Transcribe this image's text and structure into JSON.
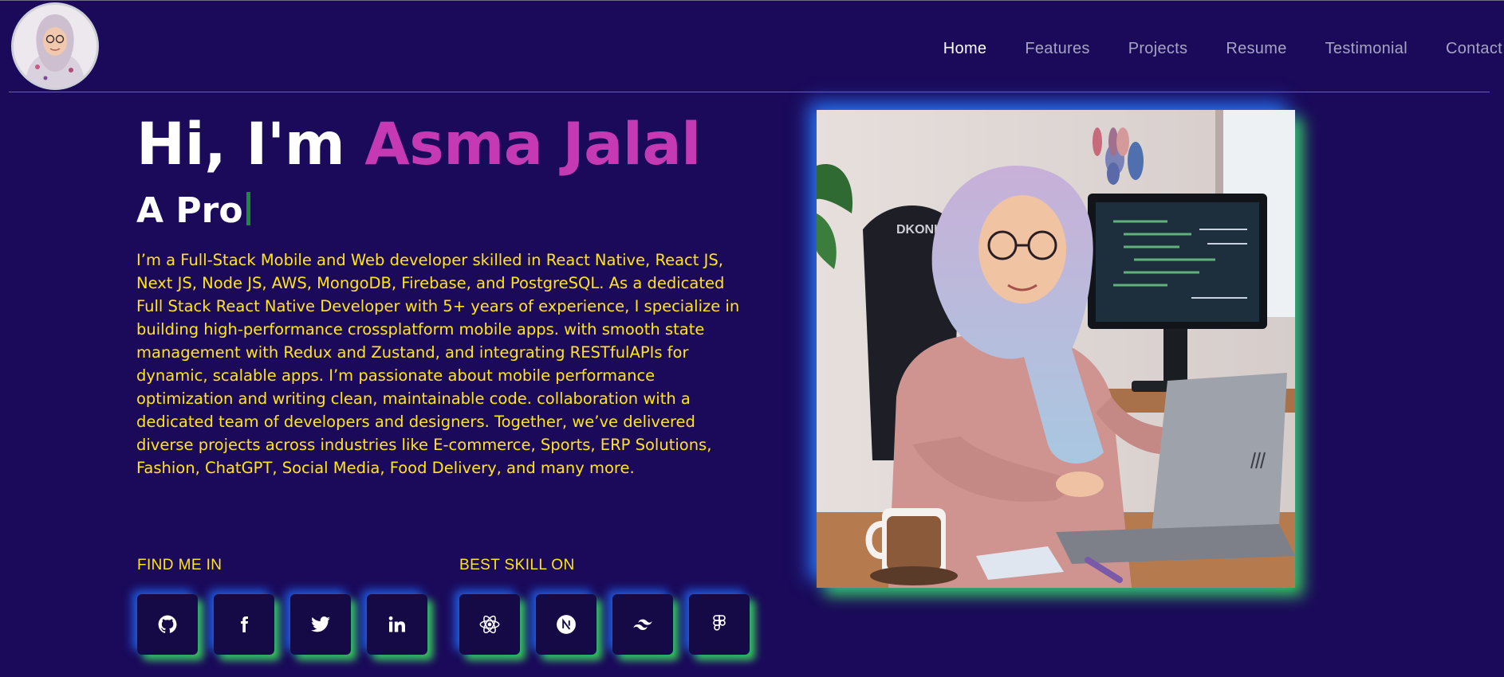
{
  "header": {
    "nav": [
      {
        "label": "Home",
        "active": true
      },
      {
        "label": "Features",
        "active": false
      },
      {
        "label": "Projects",
        "active": false
      },
      {
        "label": "Resume",
        "active": false
      },
      {
        "label": "Testimonial",
        "active": false
      },
      {
        "label": "Contact",
        "active": false
      }
    ]
  },
  "hero": {
    "greeting": "Hi, I'm ",
    "name": "Asma Jalal",
    "typing_text": "A Pro",
    "bio": "I’m a Full-Stack Mobile and Web developer skilled in React Native, React JS,\nNext JS, Node JS, AWS, MongoDB, Firebase, and PostgreSQL. As a dedicated\nFull Stack React Native Developer with 5+ years of experience, I specialize in\nbuilding high-performance crossplatform mobile apps. with smooth state\nmanagement with Redux and Zustand, and integrating RESTfulAPIs for\ndynamic, scalable apps. I’m passionate about mobile performance\noptimization and writing clean, maintainable code. collaboration with a\ndedicated team of developers and designers. Together, we’ve delivered\ndiverse projects across industries like E-commerce, Sports, ERP Solutions,\nFashion, ChatGPT, Social Media, Food Delivery, and many more."
  },
  "social": {
    "label": "FIND ME IN",
    "items": [
      {
        "icon": "github-icon"
      },
      {
        "icon": "facebook-icon"
      },
      {
        "icon": "twitter-icon"
      },
      {
        "icon": "linkedin-icon"
      }
    ]
  },
  "skills": {
    "label": "BEST SKILL ON",
    "items": [
      {
        "icon": "react-icon"
      },
      {
        "icon": "nextjs-icon"
      },
      {
        "icon": "tailwind-icon"
      },
      {
        "icon": "figma-icon"
      }
    ]
  },
  "colors": {
    "background": "#1b0a5a",
    "accent_name": "#c639b5",
    "bio_text": "#ffe41a",
    "glow_blue": "#1e6eff",
    "glow_green": "#3cdc5a"
  }
}
